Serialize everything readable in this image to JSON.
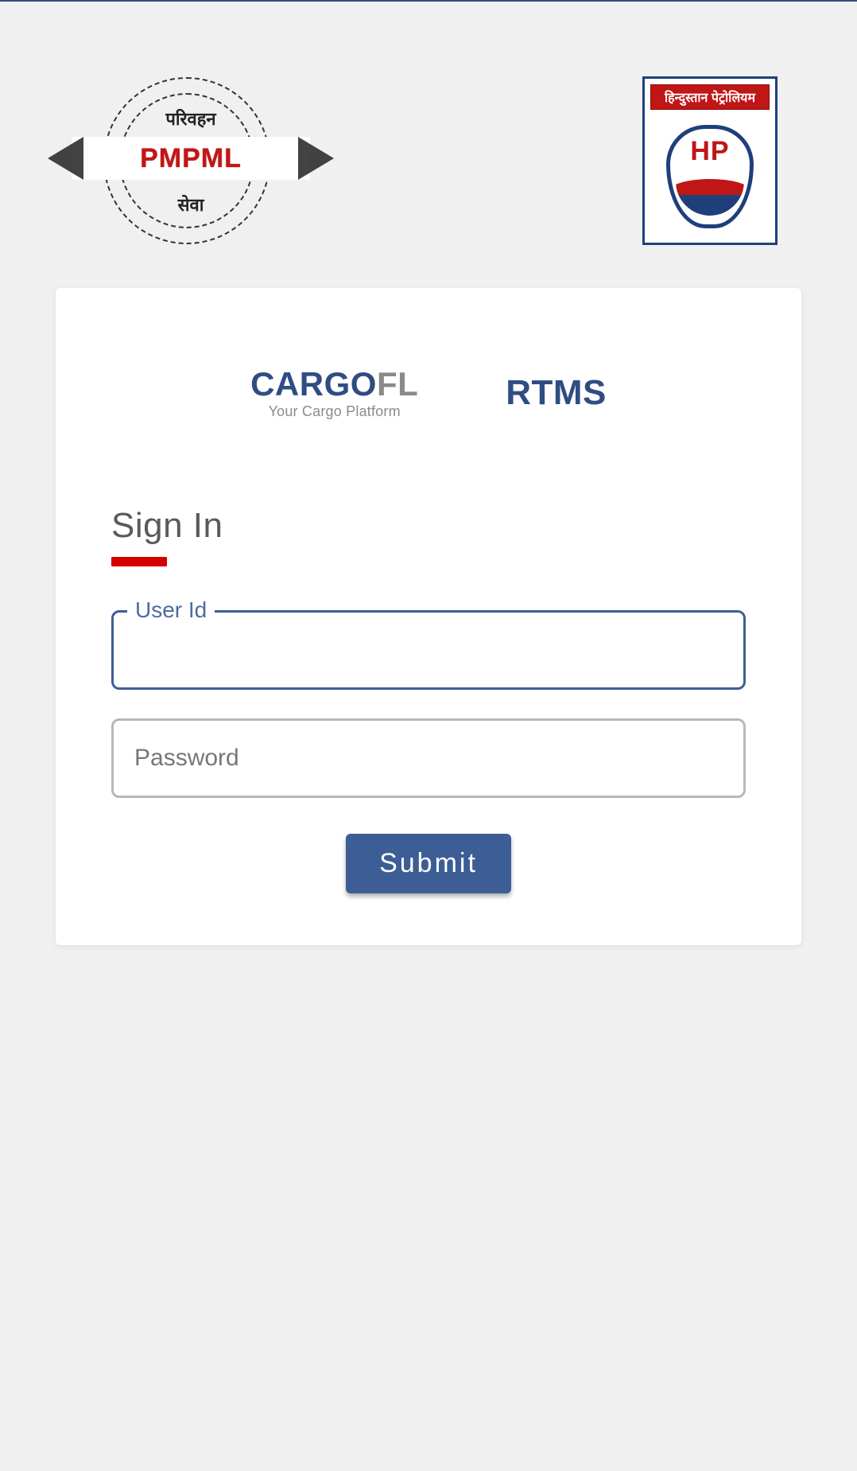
{
  "colors": {
    "brand_blue": "#2f4d82",
    "accent_red": "#d40000",
    "hp_blue": "#1f3f7a",
    "hp_red": "#c01616"
  },
  "header": {
    "pmpml_logo": {
      "top_text": "परिवहन",
      "band_text": "PMPML",
      "bottom_text": "सेवा"
    },
    "hp_logo": {
      "header_text": "हिन्दुस्तान पेट्रोलियम",
      "mark_text": "HP"
    }
  },
  "card": {
    "brand": {
      "cargo_prefix": "CARGO",
      "cargo_suffix": "FL",
      "cargo_tagline": "Your Cargo Platform",
      "rtms": "RTMS"
    },
    "form": {
      "title": "Sign In",
      "user_id_label": "User Id",
      "user_id_value": "",
      "password_placeholder": "Password",
      "password_value": "",
      "submit_label": "Submit"
    }
  }
}
